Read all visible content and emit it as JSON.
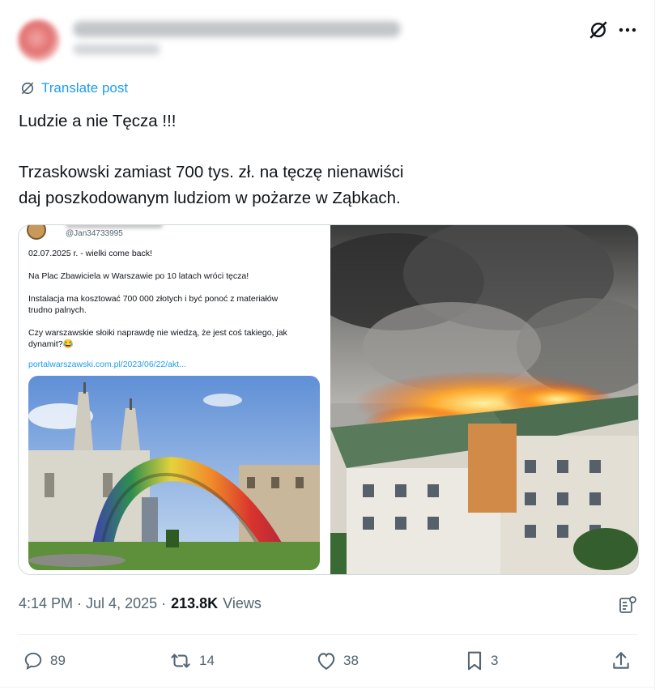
{
  "post": {
    "translate_label": "Translate post",
    "text": "Ludzie a nie Tęcza !!!\n\nTrzaskowski zamiast 700 tys. zł. na tęczę nienawiści\ndaj poszkodowanym ludziom w pożarze w Ząbkach.",
    "time": "4:14 PM",
    "date": "Jul 4, 2025",
    "views_count": "213.8K",
    "views_label": "Views"
  },
  "embedded_screenshot": {
    "handle": "@Jan34733995",
    "text": "02.07.2025 r. - wielki come back!\n\nNa Plac Zbawiciela w Warszawie po 10 latach wróci tęcza!\n\nInstalacja ma kosztować 700 000 złotych i być ponoć z materiałów\ntrudno palnych.\n\nCzy warszawskie słoiki naprawdę nie wiedzą, że jest coś takiego, jak\ndynamit?😂",
    "link": "portalwarszawski.com.pl/2023/06/22/akt..."
  },
  "actions": {
    "replies": "89",
    "reposts": "14",
    "likes": "38",
    "bookmarks": "3"
  },
  "icons": [
    "grok-icon",
    "more-icon",
    "translate-icon",
    "reply-icon",
    "repost-icon",
    "like-icon",
    "bookmark-icon",
    "share-icon",
    "analytics-icon"
  ],
  "colors": {
    "accent": "#1d9bf0",
    "muted": "#536471",
    "text": "#0f1419"
  }
}
